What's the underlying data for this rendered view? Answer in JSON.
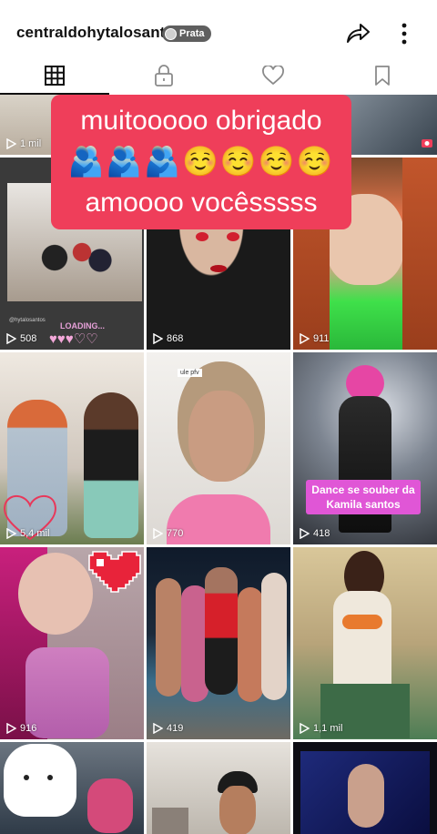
{
  "header": {
    "username": "centraldohytalosants",
    "badge_label": "Prata",
    "share_icon": "share-arrow-icon",
    "more_icon": "more-vertical-icon"
  },
  "tabs": [
    {
      "icon": "grid-icon",
      "active": true
    },
    {
      "icon": "lock-icon",
      "active": false
    },
    {
      "icon": "heart-icon",
      "active": false
    },
    {
      "icon": "bookmark-icon",
      "active": false
    }
  ],
  "banner": {
    "line1": "muitooooo obrigado",
    "line2": "🫂🫂🫂☺️☺️☺️☺️",
    "line3": "amoooo vocêsssss"
  },
  "grid": {
    "row0": [
      "1 mil",
      "",
      ""
    ],
    "row1": [
      "508",
      "868",
      "911"
    ],
    "row2": [
      "5,4 mil",
      "770",
      "418"
    ],
    "row3": [
      "916",
      "419",
      "1,1 mil"
    ],
    "overlay_texts": {
      "handle": "@hytalosantos",
      "loading": "LOADING...",
      "caption_kamila": "Dance se souber da Kamila santos",
      "partial_caption": "ule pfv"
    }
  },
  "colors": {
    "banner": "#ef3e5a",
    "caption_box": "#e056d6",
    "badge": "#5f5f5f"
  }
}
